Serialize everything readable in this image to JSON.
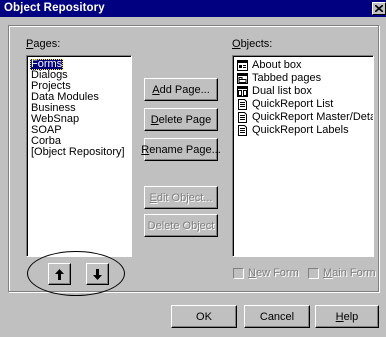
{
  "window": {
    "title": "Object Repository"
  },
  "pages": {
    "label_prefix": "",
    "label_accel": "P",
    "label_rest": "ages:",
    "items": [
      "Forms",
      "Dialogs",
      "Projects",
      "Data Modules",
      "Business",
      "WebSnap",
      "SOAP",
      "Corba",
      "[Object Repository]"
    ],
    "selected": "Forms"
  },
  "objects": {
    "label_accel": "O",
    "label_rest": "bjects:",
    "items": [
      {
        "label": "About box",
        "icon": "form-icon"
      },
      {
        "label": "Tabbed pages",
        "icon": "tabbed-form-icon"
      },
      {
        "label": "Dual list box",
        "icon": "dual-list-icon"
      },
      {
        "label": "QuickReport List",
        "icon": "report-icon"
      },
      {
        "label": "QuickReport Master/Detail",
        "icon": "report-icon"
      },
      {
        "label": "QuickReport Labels",
        "icon": "report-icon"
      }
    ]
  },
  "buttons": {
    "add_page": {
      "accel": "A",
      "rest": "dd Page..."
    },
    "delete_page": {
      "accel": "D",
      "rest": "elete Page"
    },
    "rename_page": {
      "accel": "R",
      "rest": "ename Page..."
    },
    "edit_object": {
      "accel": "E",
      "rest": "dit Object..."
    },
    "delete_object": {
      "text": "Delete Object"
    },
    "ok": "OK",
    "cancel": "Cancel",
    "help": {
      "accel": "H",
      "rest": "elp"
    }
  },
  "checkboxes": {
    "new_form": {
      "accel": "N",
      "rest": "ew Form",
      "checked": false
    },
    "main_form": {
      "accel": "M",
      "rest": "ain Form",
      "checked": false
    }
  }
}
